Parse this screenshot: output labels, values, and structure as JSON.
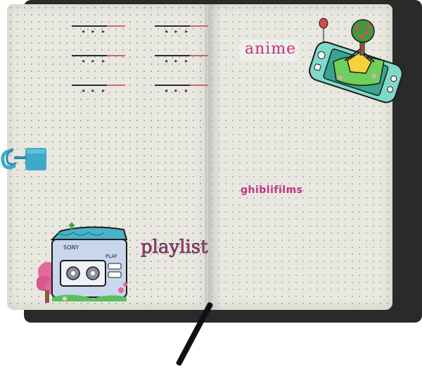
{
  "labels": {
    "anime": "anime",
    "ghibli": "ghiblifilms",
    "playlist": "playlist"
  },
  "cassette": {
    "brand": "SONY",
    "mode": "PLAY"
  },
  "song_rows": 3,
  "song_columns": 2,
  "controls_glyph": "◂ ▸ ▸",
  "colors": {
    "page": "#e8e8e1",
    "cover": "#2a2a2a",
    "ink_pink": "#c13482",
    "clip_blue": "#3ea9c8",
    "console_teal": "#66d8c9",
    "cassette_blue": "#7fb8d8"
  }
}
